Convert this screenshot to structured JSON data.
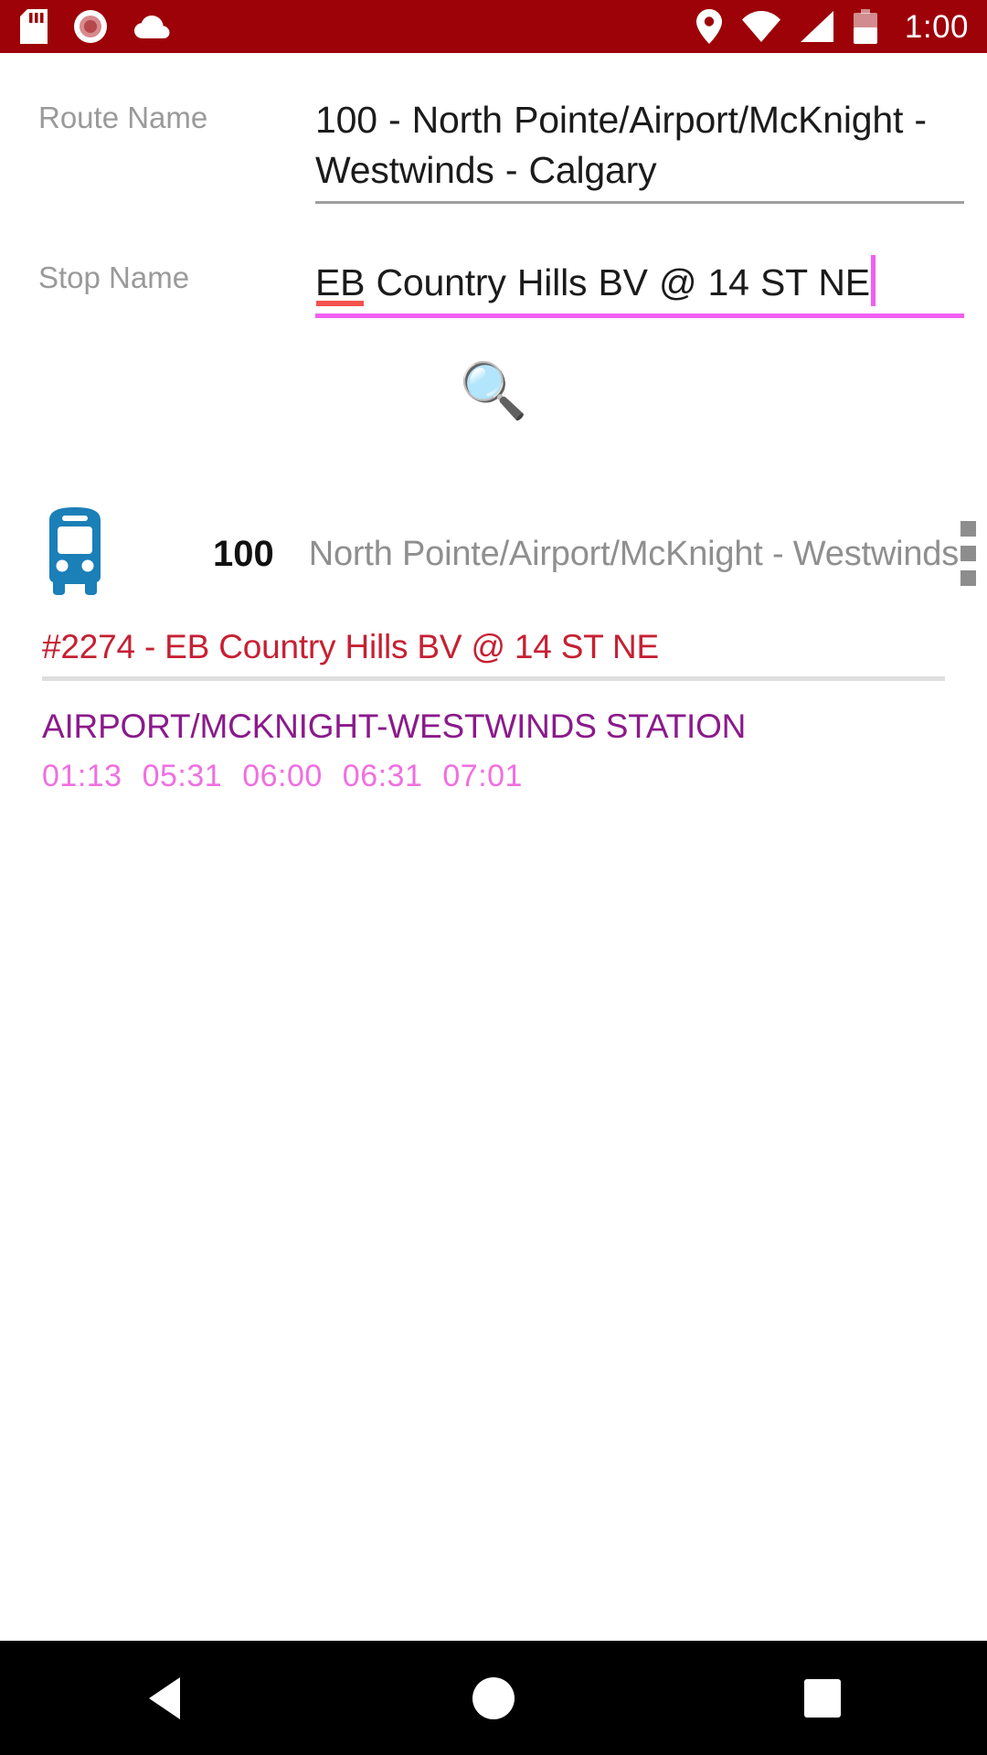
{
  "status_bar": {
    "background_color": "#9c0208",
    "left_icons": [
      {
        "name": "sd-card-icon"
      },
      {
        "name": "screen-record-icon"
      },
      {
        "name": "cloud-icon"
      }
    ],
    "right_icons": [
      {
        "name": "location-pin-icon"
      },
      {
        "name": "wifi-icon"
      },
      {
        "name": "cellular-signal-icon"
      },
      {
        "name": "battery-icon"
      }
    ],
    "time": "1:00"
  },
  "form": {
    "route": {
      "label": "Route Name",
      "value": "100 - North Pointe/Airport/McKnight - Westwinds - Calgary",
      "focused": false
    },
    "stop": {
      "label": "Stop Name",
      "misspelled_prefix": "EB",
      "value_rest": " Country Hills BV @ 14 ST NE",
      "value": "EB Country Hills BV @ 14 ST NE",
      "focused": true,
      "focus_color": "#f15ff0",
      "spellcheck_color": "#f4524d"
    }
  },
  "search": {
    "icon": "magnifying-glass-icon",
    "glyph": "🔍"
  },
  "result": {
    "bus_icon": "bus-front-icon",
    "bus_icon_color": "#1b7fb8",
    "route_number": "100",
    "route_description": "North Pointe/Airport/McKnight - Westwinds",
    "overflow_icon": "more-vertical-icon"
  },
  "stop_details": {
    "header": "#2274 - EB Country Hills BV @ 14 ST NE",
    "header_color": "#c62033",
    "destination": "AIRPORT/MCKNIGHT-WESTWINDS STATION",
    "destination_color": "#8b1a8b",
    "times": [
      "01:13",
      "05:31",
      "06:00",
      "06:31",
      "07:01"
    ],
    "times_color": "#f06fe0"
  },
  "nav_bar": {
    "back": "back-button",
    "home": "home-button",
    "recents": "recents-button"
  }
}
